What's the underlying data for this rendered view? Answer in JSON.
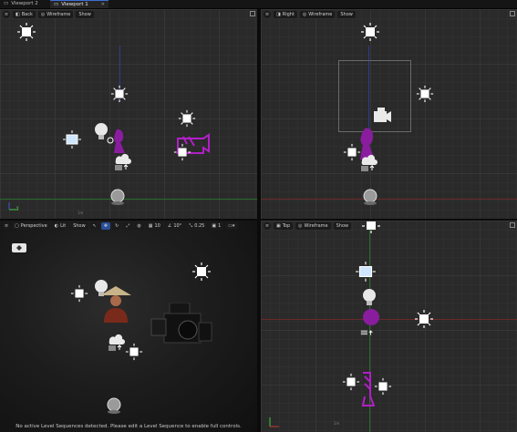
{
  "tabs": [
    {
      "label": "Viewport 2"
    },
    {
      "label": "Viewport 1"
    }
  ],
  "viewports": {
    "back": {
      "view_label": "Back",
      "mode_label": "Wireframe",
      "show_label": "Show"
    },
    "right": {
      "view_label": "Right",
      "mode_label": "Wireframe",
      "show_label": "Show"
    },
    "perspective": {
      "view_label": "Perspective",
      "mode_label": "Lit",
      "show_label": "Show",
      "grid_size": "10",
      "rotation_snap": "10°",
      "scale_snap": "0.25",
      "camera_speed": "1",
      "message": "No active Level Sequences detected. Please edit a Level Sequence to enable full controls."
    },
    "top": {
      "view_label": "Top",
      "mode_label": "Wireframe",
      "show_label": "Show"
    }
  },
  "axis_hints": {
    "back": "Y",
    "scale": "1m"
  },
  "colors": {
    "grid_bg": "#2a2a2a",
    "axis_blue": "#2d3c8c",
    "axis_red": "#6a2a2a",
    "axis_green": "#2c6a2c",
    "accent": "#3a6fd8",
    "selection_purple": "#8a1c9e"
  }
}
